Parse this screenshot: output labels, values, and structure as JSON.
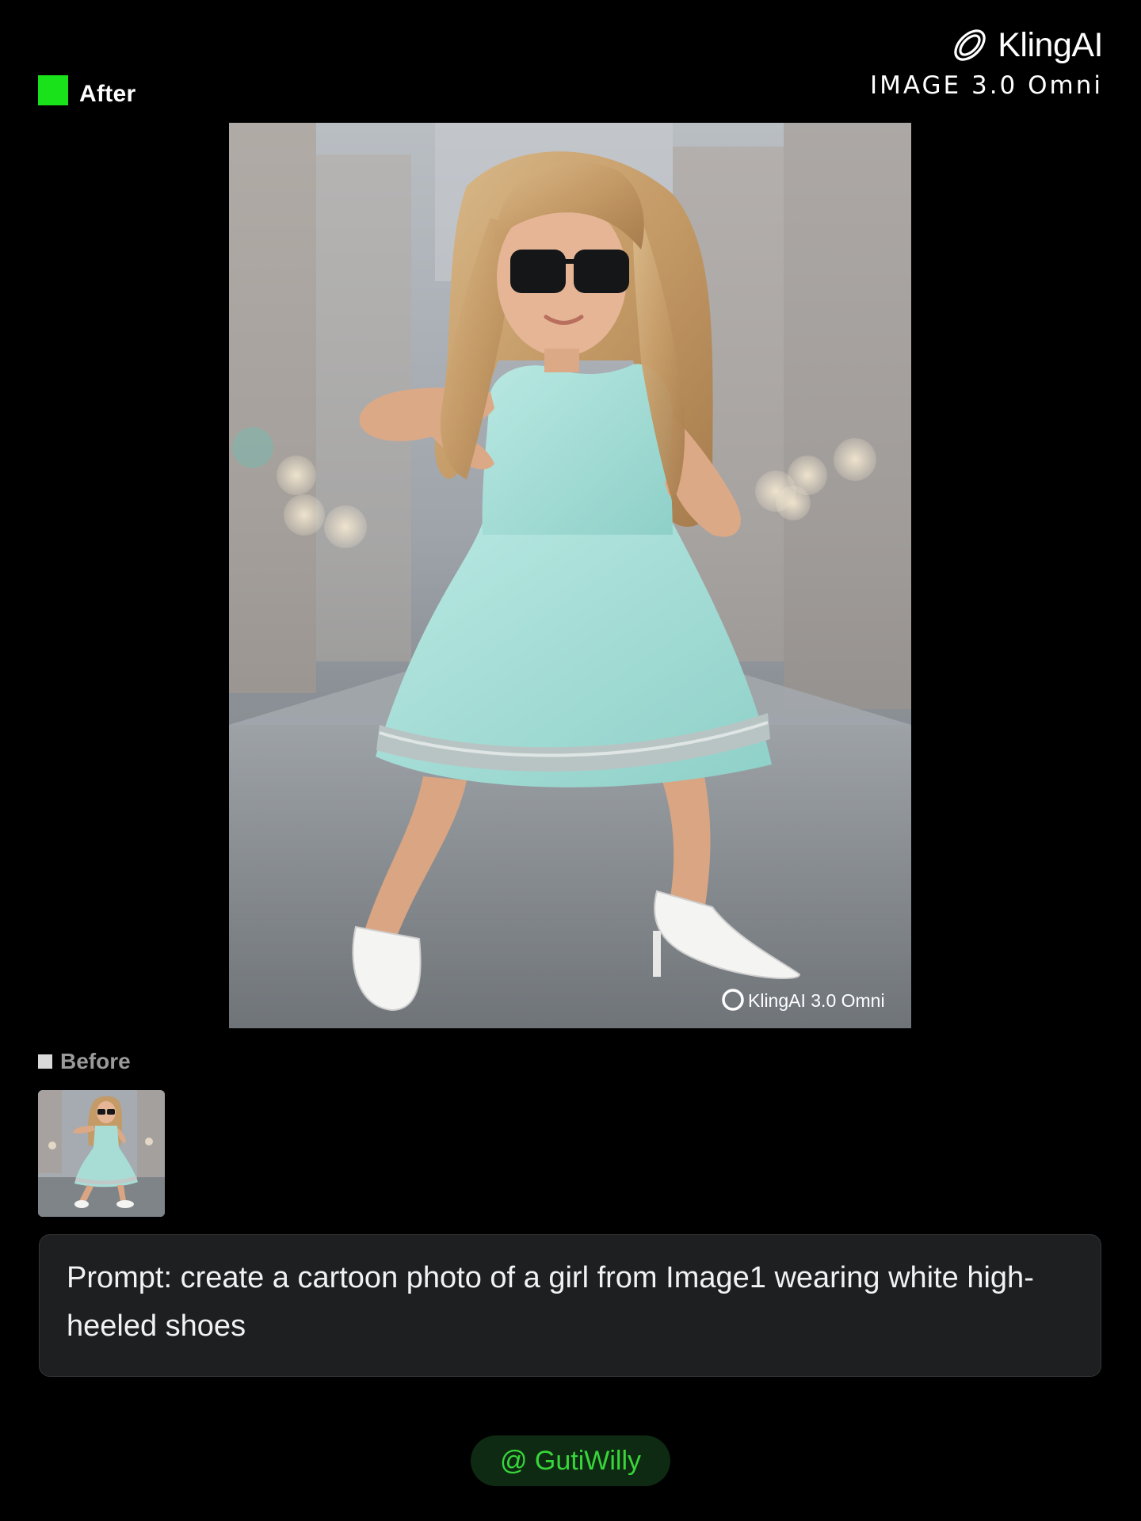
{
  "header": {
    "after_label": "After",
    "brand_name": "KlingAI",
    "brand_model": "IMAGE 3.0 Omni",
    "brand_logo_icon": "kling-logo-icon",
    "accent_color": "#19e11a"
  },
  "main_image": {
    "watermark": "KlingAI 3.0 Omni",
    "watermark_icon": "kling-logo-icon"
  },
  "before": {
    "label": "Before"
  },
  "prompt": {
    "text": "Prompt: create a cartoon photo of a girl from Image1 wearing white high-heeled shoes"
  },
  "credit": {
    "text": "@ GutiWilly",
    "color": "#38d63a"
  }
}
